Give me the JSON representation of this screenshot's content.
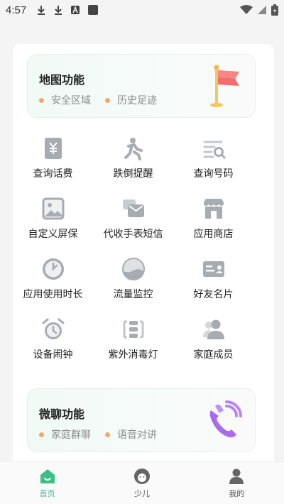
{
  "status_bar": {
    "time": "4:57"
  },
  "map_feature": {
    "title": "地图功能",
    "tags": [
      "安全区域",
      "历史足迹"
    ]
  },
  "grid": [
    [
      {
        "label": "查询话费",
        "icon": "bill-icon"
      },
      {
        "label": "跌倒提醒",
        "icon": "fall-icon"
      },
      {
        "label": "查询号码",
        "icon": "number-search-icon"
      }
    ],
    [
      {
        "label": "自定义屏保",
        "icon": "picture-icon"
      },
      {
        "label": "代收手表短信",
        "icon": "sms-icon"
      },
      {
        "label": "应用商店",
        "icon": "store-icon"
      }
    ],
    [
      {
        "label": "应用使用时长",
        "icon": "clock-icon"
      },
      {
        "label": "流量监控",
        "icon": "data-icon"
      },
      {
        "label": "好友名片",
        "icon": "card-icon"
      }
    ],
    [
      {
        "label": "设备闹钟",
        "icon": "alarm-icon"
      },
      {
        "label": "紫外消毒灯",
        "icon": "uv-lamp-icon"
      },
      {
        "label": "家庭成员",
        "icon": "family-icon"
      }
    ]
  ],
  "chat_feature": {
    "title": "微聊功能",
    "tags": [
      "家庭群聊",
      "语音对讲"
    ]
  },
  "bottom_nav": [
    {
      "label": "首页",
      "icon": "home-icon",
      "active": true
    },
    {
      "label": "少儿",
      "icon": "kid-icon",
      "active": false
    },
    {
      "label": "我的",
      "icon": "profile-icon",
      "active": false
    }
  ],
  "colors": {
    "accent": "#3cbf84",
    "icon_gray": "#a7acb3",
    "tag_dot": "#f3a86b"
  }
}
